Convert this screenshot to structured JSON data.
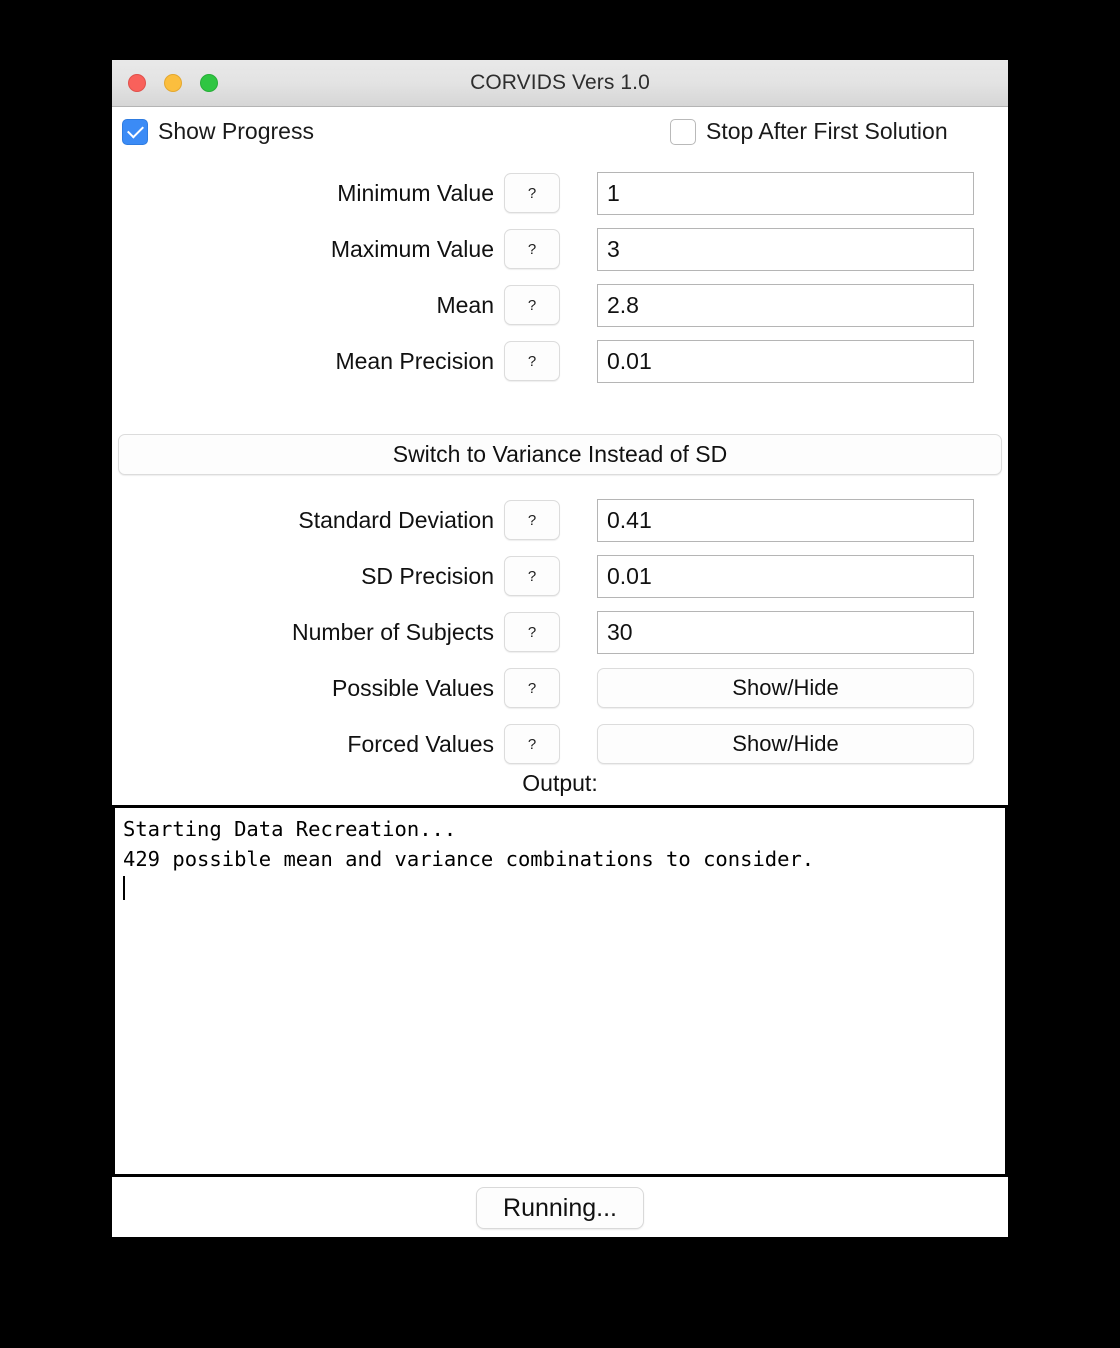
{
  "window": {
    "title": "CORVIDS Vers 1.0",
    "traffic_lights": [
      "close-button",
      "minimize-button",
      "maximize-button"
    ]
  },
  "options": {
    "show_progress": {
      "label": "Show Progress",
      "checked": true
    },
    "stop_after_first_solution": {
      "label": "Stop After First Solution",
      "checked": false
    }
  },
  "help_glyph": "?",
  "switch_button": {
    "label": "Switch to Variance Instead of SD"
  },
  "fields": [
    {
      "label": "Minimum Value",
      "help": "?",
      "value": "1",
      "kind": "text"
    },
    {
      "label": "Maximum Value",
      "help": "?",
      "value": "3",
      "kind": "text"
    },
    {
      "label": "Mean",
      "help": "?",
      "value": "2.8",
      "kind": "text"
    },
    {
      "label": "Mean Precision",
      "help": "?",
      "value": "0.01",
      "kind": "text"
    },
    {
      "label": "Standard Deviation",
      "help": "?",
      "value": "0.41",
      "kind": "text"
    },
    {
      "label": "SD Precision",
      "help": "?",
      "value": "0.01",
      "kind": "text"
    },
    {
      "label": "Number of Subjects",
      "help": "?",
      "value": "30",
      "kind": "text"
    },
    {
      "label": "Possible Values",
      "help": "?",
      "value": "Show/Hide",
      "kind": "button"
    },
    {
      "label": "Forced Values",
      "help": "?",
      "value": "Show/Hide",
      "kind": "button"
    }
  ],
  "output": {
    "label": "Output:",
    "lines": [
      "Starting Data Recreation...",
      "429 possible mean and variance combinations to consider."
    ]
  },
  "footer": {
    "run_label": "Running..."
  },
  "colors": {
    "checkbox_accent": "#3b8bf6",
    "titlebar": "#e3e3e3",
    "close": "#f9615b",
    "minimize": "#fbbe3e",
    "maximize": "#2fc642",
    "output_border": "#000000"
  }
}
